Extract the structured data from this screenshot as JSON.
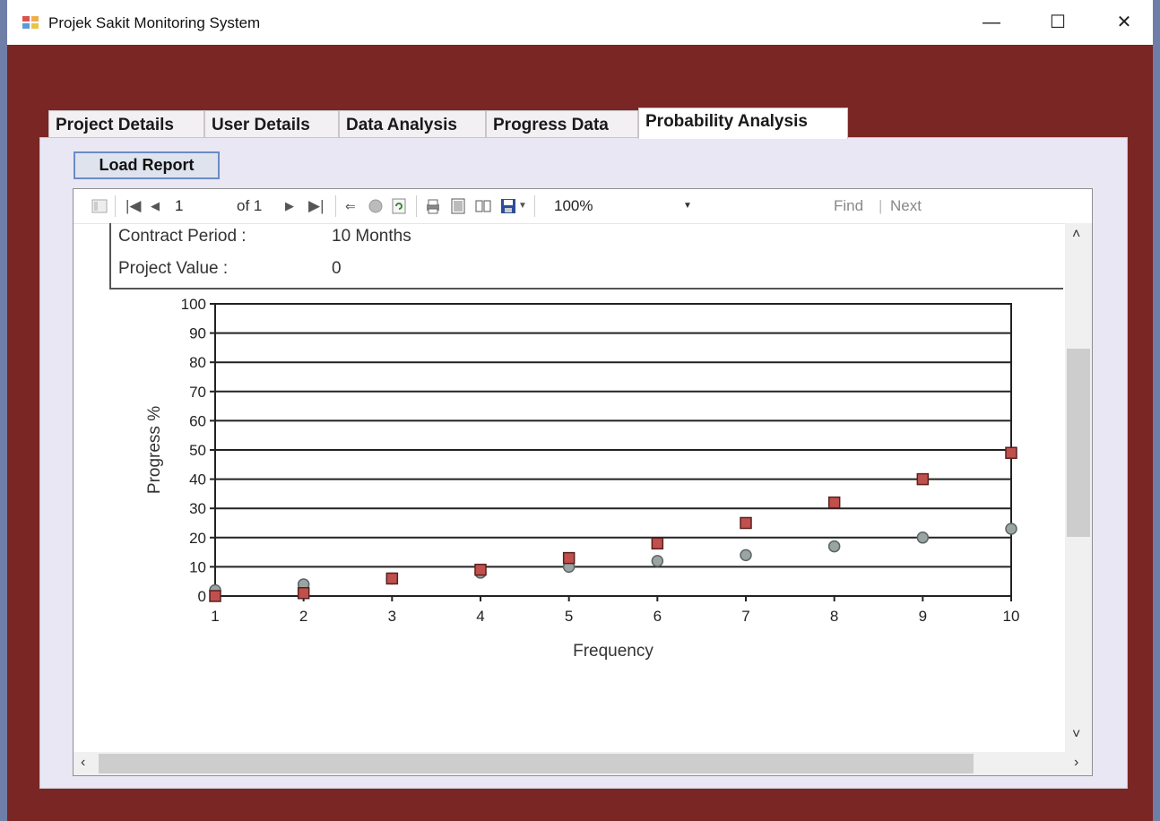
{
  "window": {
    "title": "Projek Sakit Monitoring System",
    "minimize": "—",
    "maximize": "☐",
    "close": "✕"
  },
  "tabs": [
    {
      "label": "Project Details",
      "active": false
    },
    {
      "label": "User Details",
      "active": false
    },
    {
      "label": "Data Analysis",
      "active": false
    },
    {
      "label": "Progress Data",
      "active": false
    },
    {
      "label": "Probability Analysis",
      "active": true
    }
  ],
  "buttons": {
    "load_report": "Load Report"
  },
  "viewer_toolbar": {
    "page_current": "1",
    "page_of": "of 1",
    "zoom": "100%",
    "find": "Find",
    "next": "Next"
  },
  "report": {
    "contract_period_label": "Contract Period :",
    "contract_period_value": "10 Months",
    "project_value_label": "Project Value :",
    "project_value_value": "0"
  },
  "chart_data": {
    "type": "scatter",
    "xlabel": "Frequency",
    "ylabel": "Progress %",
    "x": [
      1,
      2,
      3,
      4,
      5,
      6,
      7,
      8,
      9,
      10
    ],
    "xlim": [
      1,
      10
    ],
    "ylim": [
      0,
      100
    ],
    "yticks": [
      0,
      10,
      20,
      30,
      40,
      50,
      60,
      70,
      80,
      90,
      100
    ],
    "grid": true,
    "series": [
      {
        "marker": "square",
        "color": "#c0504d",
        "values": [
          0,
          1,
          6,
          9,
          13,
          18,
          25,
          32,
          40,
          49
        ]
      },
      {
        "marker": "circle",
        "color": "#9aa5a3",
        "values": [
          2,
          4,
          6,
          8,
          10,
          12,
          14,
          17,
          20,
          23
        ]
      }
    ]
  }
}
